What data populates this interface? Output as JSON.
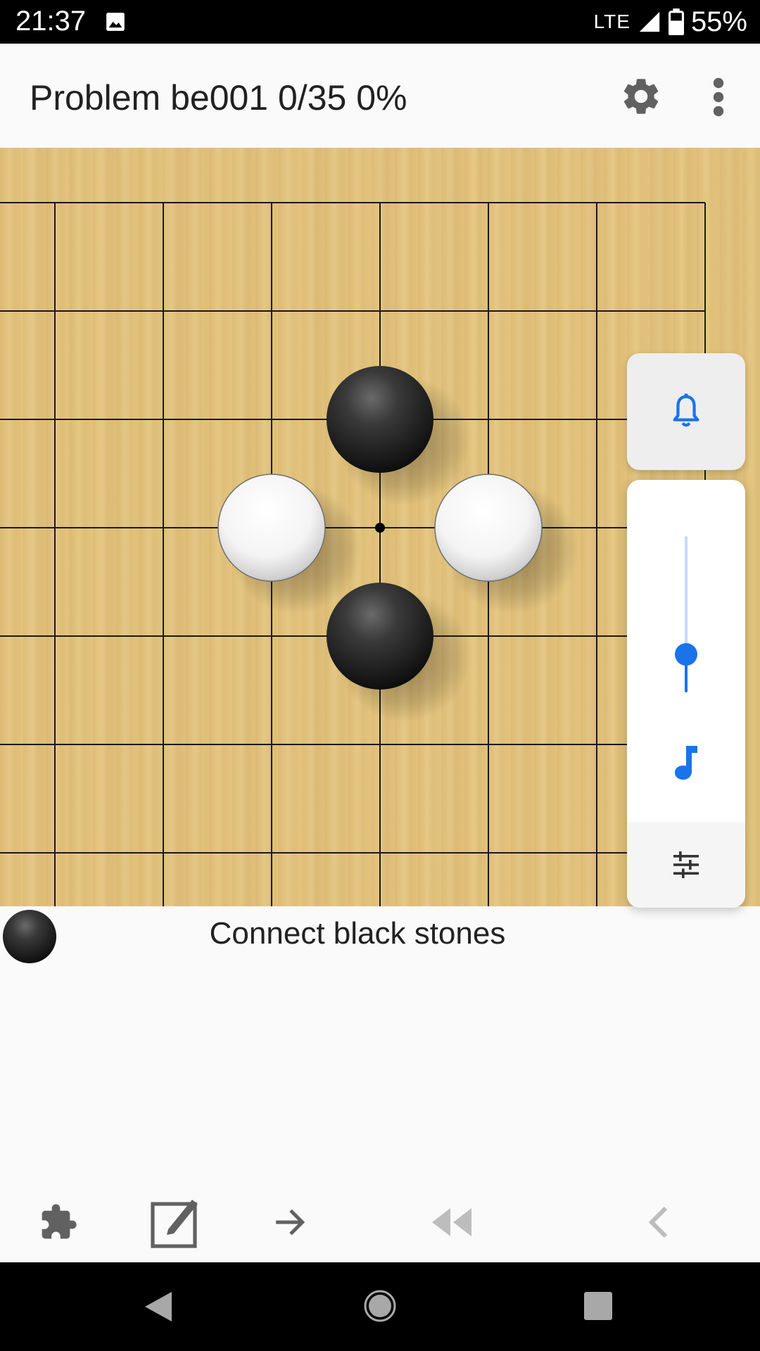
{
  "status_bar": {
    "time": "21:37",
    "network": "LTE",
    "battery": "55%",
    "icons": [
      "image-icon",
      "signal-icon",
      "battery-icon"
    ]
  },
  "app_bar": {
    "title": "Problem be001 0/35 0%",
    "icons": [
      "gear-icon",
      "more-vert-icon"
    ]
  },
  "board": {
    "grid": "partial 19x19 view",
    "stones": [
      {
        "color": "black",
        "col": 3,
        "row": 2
      },
      {
        "color": "white",
        "col": 2,
        "row": 3
      },
      {
        "color": "white",
        "col": 4,
        "row": 3
      },
      {
        "color": "black",
        "col": 3,
        "row": 4
      }
    ],
    "star_point": {
      "col": 3,
      "row": 3
    }
  },
  "volume_panel": {
    "icons": [
      "bell-icon",
      "music-note-icon",
      "tune-icon"
    ],
    "media_level": 0.25,
    "accent_color": "#1a73e8"
  },
  "caption": {
    "to_play": "black",
    "text": "Connect black stones"
  },
  "toolbar": {
    "icons": [
      "puzzle-icon",
      "edit-icon",
      "arrow-right-icon",
      "rewind-icon",
      "chevron-left-icon"
    ]
  },
  "nav_bar": {
    "icons": [
      "back-icon",
      "home-icon",
      "recents-icon"
    ]
  }
}
